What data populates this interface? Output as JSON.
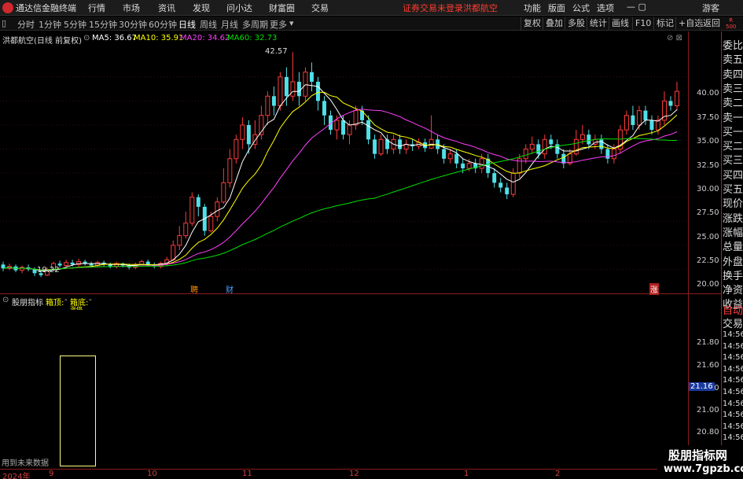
{
  "menubar": {
    "app_title": "通达信金融终端",
    "menu": [
      "行情",
      "市场",
      "资讯",
      "发现",
      "问小达",
      "财富圈",
      "交易"
    ],
    "warning": "证券交易未登录",
    "stock_name": "洪都航空",
    "right": [
      "功能",
      "版面",
      "公式",
      "选项"
    ],
    "guest": "游客"
  },
  "toolbar": {
    "periods": [
      "分时",
      "1分钟",
      "5分钟",
      "15分钟",
      "30分钟",
      "60分钟",
      "日线",
      "周线",
      "月线",
      "多周期",
      "更多"
    ],
    "active_period": "日线",
    "buttons": [
      "复权",
      "叠加",
      "多股",
      "统计",
      "画线",
      "F10",
      "标记",
      "+自选",
      "返回"
    ]
  },
  "chart_header": {
    "title": "洪都航空(日线 前复权)",
    "ma5": "MA5: 36.67",
    "ma10": "MA10: 35.91",
    "ma20": "MA20: 34.62",
    "ma60": "MA60: 32.73",
    "colors": {
      "ma5": "#ffffff",
      "ma10": "#ffff00",
      "ma20": "#ff40ff",
      "ma60": "#00e000"
    }
  },
  "indicator_header": {
    "name": "股朋指标",
    "top_label": "箱顶:",
    "top_value": "-",
    "bottom_label": "箱底:",
    "bottom_value": "-",
    "sub": "涨停"
  },
  "annotations": {
    "high": "42.57",
    "low": "19.22",
    "event1": "聘",
    "event2": "财",
    "event3": "涨",
    "future_note": "用到未来数据"
  },
  "price_axis": [
    "40.00",
    "37.50",
    "35.00",
    "32.50",
    "30.00",
    "27.50",
    "25.00",
    "22.50",
    "20.00"
  ],
  "indicator_axis": [
    "21.80",
    "21.60",
    "21.40",
    "21.16",
    "21.00",
    "20.80"
  ],
  "indicator_current": "21.16",
  "dates": [
    "2024年",
    "9",
    "10",
    "11",
    "12",
    "1",
    "2"
  ],
  "right_panel": {
    "header": "R",
    "sub": "500",
    "labels_top": [
      "委比",
      "卖五",
      "卖四",
      "卖三",
      "卖二",
      "卖一",
      "买一",
      "买二",
      "买三",
      "买四",
      "买五",
      "现价",
      "涨跌",
      "涨幅",
      "总量",
      "外盘",
      "换手",
      "净资",
      "收益"
    ],
    "labels_bottom": [
      "自动",
      "交易",
      "14:56",
      "14:56",
      "14:56",
      "14:56",
      "14:56",
      "14:56",
      "14:56",
      "14:56",
      "14:56",
      "14:56",
      "14:56",
      "14:56",
      "14:56"
    ]
  },
  "watermark": {
    "line1": "股朋指标网",
    "line2": "www.7gpzb.com"
  },
  "chart_data": {
    "type": "candlestick",
    "ylim": [
      17.5,
      43.5
    ],
    "candles": [
      [
        20.5,
        20.1,
        20.8,
        19.8
      ],
      [
        20.1,
        20.3,
        20.6,
        19.9
      ],
      [
        20.3,
        19.9,
        20.5,
        19.7
      ],
      [
        19.9,
        20.2,
        20.4,
        19.6
      ],
      [
        20.2,
        20.0,
        20.5,
        19.8
      ],
      [
        20.0,
        19.6,
        20.2,
        19.3
      ],
      [
        19.6,
        19.4,
        19.8,
        19.2
      ],
      [
        19.4,
        20.0,
        20.2,
        19.3
      ],
      [
        20.0,
        20.6,
        20.8,
        19.9
      ],
      [
        20.6,
        20.4,
        20.9,
        20.2
      ],
      [
        20.4,
        20.7,
        21.0,
        20.2
      ],
      [
        20.7,
        20.5,
        21.0,
        20.3
      ],
      [
        20.5,
        20.8,
        21.1,
        20.3
      ],
      [
        20.8,
        20.6,
        21.0,
        20.4
      ],
      [
        20.6,
        20.4,
        20.8,
        20.2
      ],
      [
        20.4,
        20.7,
        20.9,
        20.2
      ],
      [
        20.7,
        20.5,
        20.9,
        20.3
      ],
      [
        20.5,
        20.3,
        20.7,
        20.1
      ],
      [
        20.3,
        20.6,
        20.8,
        20.1
      ],
      [
        20.6,
        20.4,
        20.7,
        20.2
      ],
      [
        20.4,
        20.2,
        20.6,
        20.0
      ],
      [
        20.2,
        20.5,
        20.7,
        20.0
      ],
      [
        20.5,
        20.8,
        21.0,
        20.3
      ],
      [
        20.8,
        20.5,
        21.0,
        20.3
      ],
      [
        20.5,
        20.3,
        20.7,
        20.1
      ],
      [
        20.3,
        20.6,
        20.8,
        20.1
      ],
      [
        20.6,
        21.0,
        21.3,
        20.4
      ],
      [
        21.0,
        22.5,
        23.0,
        20.9
      ],
      [
        22.5,
        23.5,
        24.5,
        22.0
      ],
      [
        23.5,
        24.8,
        26.0,
        23.2
      ],
      [
        24.8,
        27.5,
        28.0,
        24.5
      ],
      [
        27.5,
        26.5,
        27.8,
        25.5
      ],
      [
        26.5,
        24.0,
        26.8,
        23.5
      ],
      [
        24.0,
        25.5,
        26.0,
        23.8
      ],
      [
        25.5,
        27.0,
        27.5,
        25.0
      ],
      [
        27.0,
        29.0,
        30.5,
        26.8
      ],
      [
        29.0,
        31.5,
        32.5,
        28.5
      ],
      [
        31.5,
        33.5,
        34.0,
        31.0
      ],
      [
        33.5,
        35.0,
        35.8,
        32.5
      ],
      [
        35.0,
        33.0,
        35.5,
        32.0
      ],
      [
        33.0,
        34.0,
        35.5,
        32.5
      ],
      [
        34.0,
        36.0,
        37.0,
        33.5
      ],
      [
        36.0,
        38.0,
        38.5,
        35.0
      ],
      [
        38.0,
        37.0,
        39.0,
        36.0
      ],
      [
        37.0,
        40.0,
        40.5,
        36.5
      ],
      [
        40.0,
        38.0,
        41.0,
        37.0
      ],
      [
        38.0,
        39.5,
        42.57,
        37.5
      ],
      [
        39.5,
        38.0,
        40.5,
        37.0
      ],
      [
        38.0,
        40.5,
        41.0,
        37.5
      ],
      [
        40.5,
        39.5,
        41.5,
        38.5
      ],
      [
        39.5,
        37.5,
        40.0,
        36.5
      ],
      [
        37.5,
        36.0,
        38.0,
        35.0
      ],
      [
        36.0,
        34.5,
        36.5,
        34.0
      ],
      [
        34.5,
        35.5,
        36.0,
        33.5
      ],
      [
        35.5,
        34.0,
        36.0,
        33.5
      ],
      [
        34.0,
        35.0,
        35.5,
        33.0
      ],
      [
        35.0,
        36.5,
        37.0,
        34.5
      ],
      [
        36.5,
        35.5,
        37.0,
        35.0
      ],
      [
        35.5,
        33.5,
        36.0,
        33.0
      ],
      [
        33.5,
        32.0,
        34.0,
        31.5
      ],
      [
        32.0,
        33.5,
        34.0,
        31.8
      ],
      [
        33.5,
        32.5,
        34.0,
        32.0
      ],
      [
        32.5,
        33.5,
        34.0,
        32.0
      ],
      [
        33.5,
        32.5,
        34.0,
        32.0
      ],
      [
        32.5,
        33.0,
        33.5,
        32.0
      ],
      [
        33.0,
        32.8,
        33.5,
        32.3
      ],
      [
        32.8,
        33.2,
        33.6,
        32.5
      ],
      [
        33.2,
        32.6,
        33.6,
        32.2
      ],
      [
        32.6,
        33.5,
        36.0,
        32.5
      ],
      [
        33.5,
        32.5,
        34.0,
        32.0
      ],
      [
        32.5,
        31.5,
        33.0,
        31.0
      ],
      [
        31.5,
        32.0,
        32.5,
        31.0
      ],
      [
        32.0,
        31.0,
        32.5,
        30.5
      ],
      [
        31.0,
        30.5,
        31.5,
        30.0
      ],
      [
        30.5,
        31.0,
        31.5,
        30.2
      ],
      [
        31.0,
        30.5,
        31.5,
        30.0
      ],
      [
        30.5,
        31.5,
        32.0,
        30.0
      ],
      [
        31.5,
        30.0,
        32.0,
        29.5
      ],
      [
        30.0,
        29.0,
        30.5,
        28.5
      ],
      [
        29.0,
        28.5,
        29.5,
        28.0
      ],
      [
        28.5,
        27.8,
        29.0,
        27.3
      ],
      [
        27.8,
        30.0,
        30.5,
        27.5
      ],
      [
        30.0,
        31.5,
        32.0,
        29.5
      ],
      [
        31.5,
        32.5,
        33.0,
        31.0
      ],
      [
        32.5,
        33.0,
        33.8,
        32.0
      ],
      [
        33.0,
        32.0,
        33.5,
        31.5
      ],
      [
        32.0,
        33.5,
        34.0,
        31.5
      ],
      [
        33.5,
        33.0,
        34.0,
        32.5
      ],
      [
        33.0,
        32.0,
        33.5,
        31.5
      ],
      [
        32.0,
        31.0,
        32.5,
        30.5
      ],
      [
        31.0,
        32.0,
        32.5,
        30.8
      ],
      [
        32.0,
        33.5,
        34.5,
        31.8
      ],
      [
        33.5,
        34.0,
        35.0,
        33.0
      ],
      [
        34.0,
        33.0,
        34.5,
        32.5
      ],
      [
        33.0,
        33.5,
        34.0,
        32.5
      ],
      [
        33.5,
        32.5,
        34.0,
        32.0
      ],
      [
        32.5,
        31.5,
        33.0,
        31.0
      ],
      [
        31.5,
        32.5,
        33.0,
        31.0
      ],
      [
        32.5,
        34.5,
        35.0,
        32.0
      ],
      [
        34.5,
        36.0,
        36.5,
        34.0
      ],
      [
        36.0,
        35.0,
        37.0,
        34.5
      ],
      [
        35.0,
        36.5,
        37.0,
        34.5
      ],
      [
        36.5,
        35.5,
        37.0,
        35.0
      ],
      [
        35.5,
        34.5,
        36.0,
        34.0
      ],
      [
        34.5,
        35.5,
        36.0,
        34.0
      ],
      [
        35.5,
        37.5,
        38.5,
        35.0
      ],
      [
        37.5,
        37.0,
        38.0,
        36.5
      ],
      [
        37.0,
        38.5,
        39.5,
        36.5
      ]
    ]
  }
}
